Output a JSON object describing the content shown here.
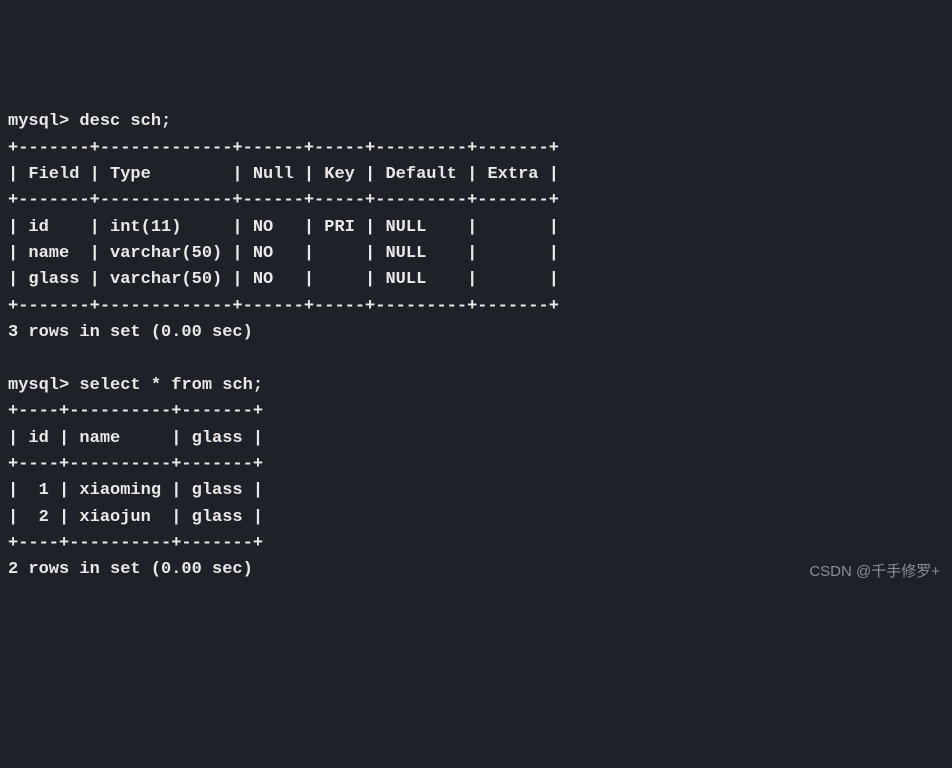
{
  "prompt": "mysql>",
  "cmd1": "desc sch;",
  "desc_border": "+-------+-------------+------+-----+---------+-------+",
  "desc_header": "| Field | Type        | Null | Key | Default | Extra |",
  "desc_rows": [
    "| id    | int(11)     | NO   | PRI | NULL    |       |",
    "| name  | varchar(50) | NO   |     | NULL    |       |",
    "| glass | varchar(50) | NO   |     | NULL    |       |"
  ],
  "desc_result": "3 rows in set (0.00 sec)",
  "cmd2": "select * from sch;",
  "sel_border": "+----+----------+-------+",
  "sel_header": "| id | name     | glass |",
  "sel_rows": [
    "|  1 | xiaoming | glass |",
    "|  2 | xiaojun  | glass |"
  ],
  "sel_result": "2 rows in set (0.00 sec)",
  "watermark": "CSDN @千手修罗+",
  "chart_data": {
    "type": "table",
    "tables": [
      {
        "title": "desc sch",
        "columns": [
          "Field",
          "Type",
          "Null",
          "Key",
          "Default",
          "Extra"
        ],
        "rows": [
          [
            "id",
            "int(11)",
            "NO",
            "PRI",
            "NULL",
            ""
          ],
          [
            "name",
            "varchar(50)",
            "NO",
            "",
            "NULL",
            ""
          ],
          [
            "glass",
            "varchar(50)",
            "NO",
            "",
            "NULL",
            ""
          ]
        ],
        "footer": "3 rows in set (0.00 sec)"
      },
      {
        "title": "select * from sch",
        "columns": [
          "id",
          "name",
          "glass"
        ],
        "rows": [
          [
            1,
            "xiaoming",
            "glass"
          ],
          [
            2,
            "xiaojun",
            "glass"
          ]
        ],
        "footer": "2 rows in set (0.00 sec)"
      }
    ]
  }
}
